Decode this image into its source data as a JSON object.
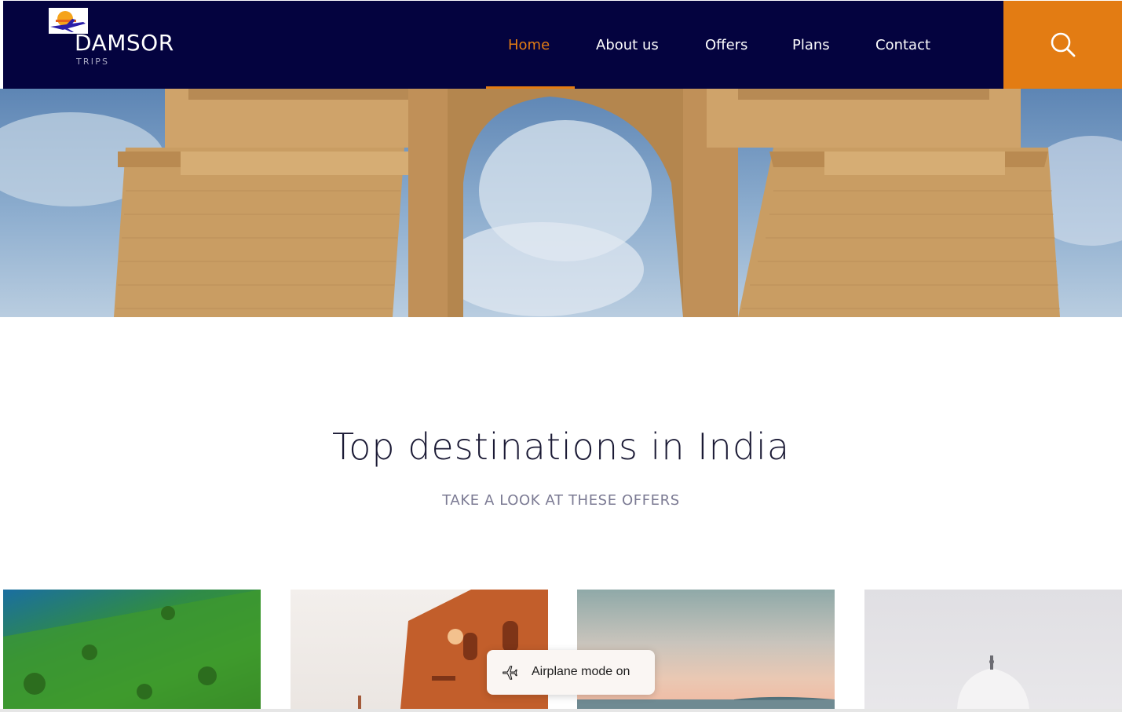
{
  "brand": {
    "name": "DAMSOR",
    "tagline": "TRIPS"
  },
  "nav": {
    "items": [
      {
        "label": "Home",
        "active": true
      },
      {
        "label": "About us",
        "active": false
      },
      {
        "label": "Offers",
        "active": false
      },
      {
        "label": "Plans",
        "active": false
      },
      {
        "label": "Contact",
        "active": false
      }
    ],
    "search_icon": "search-icon"
  },
  "section": {
    "title": "Top destinations in India",
    "subtitle": "TAKE A LOOK AT THESE OFFERS"
  },
  "toast": {
    "text": "Airplane mode on",
    "icon": "airplane-icon"
  },
  "colors": {
    "header_bg": "#04033f",
    "accent": "#e37c13",
    "title_text": "#1b1a35",
    "subtitle_text": "#7b7a93"
  }
}
